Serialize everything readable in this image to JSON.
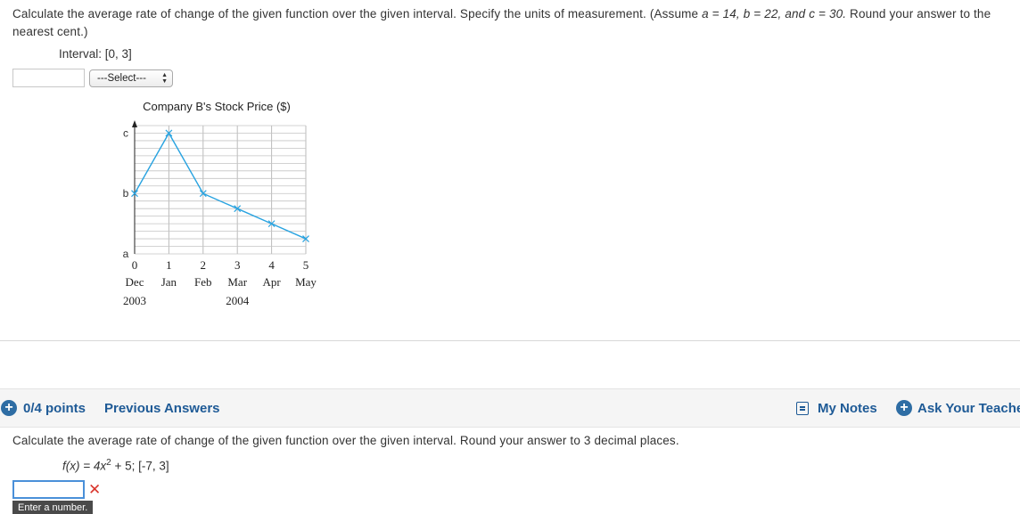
{
  "question1": {
    "text_part1": "Calculate the average rate of change of the given function over the given interval. Specify the units of measurement. (Assume ",
    "assume_a": "a = 14, ",
    "assume_b": "b = 22, ",
    "assume_c": "and c = 30.",
    "text_part2": " Round your answer to the nearest cent.)",
    "interval": "Interval: [0, 3]",
    "answer_value": "",
    "select_label": "---Select---"
  },
  "chart_data": {
    "type": "line",
    "title": "Company B's Stock Price ($)",
    "x": [
      0,
      1,
      2,
      3,
      4,
      5
    ],
    "x_tick_labels": [
      "0",
      "1",
      "2",
      "3",
      "4",
      "5"
    ],
    "month_labels": [
      "Dec",
      "Jan",
      "Feb",
      "Mar",
      "Apr",
      "May"
    ],
    "year_labels": [
      "2003",
      "2004"
    ],
    "y_tick_labels": [
      "c",
      "b",
      "a"
    ],
    "y_tick_values": [
      30,
      22,
      14
    ],
    "series": [
      {
        "values": [
          22,
          30,
          22,
          20,
          18,
          16
        ]
      }
    ],
    "ylim": [
      14,
      31
    ],
    "grid": true,
    "line_color": "#29a3e0"
  },
  "question2": {
    "points": "0/4 points",
    "previous_answers": "Previous Answers",
    "my_notes": "My Notes",
    "ask_teacher": "Ask Your Teache",
    "text": "Calculate the average rate of change of the given function over the given interval. Round your answer to 3 decimal places.",
    "func_lhs": "f(x) = 4x",
    "func_exp": "2",
    "func_rhs": " + 5;   [-7, 3]",
    "answer_value": "",
    "tooltip": "Enter a number."
  }
}
